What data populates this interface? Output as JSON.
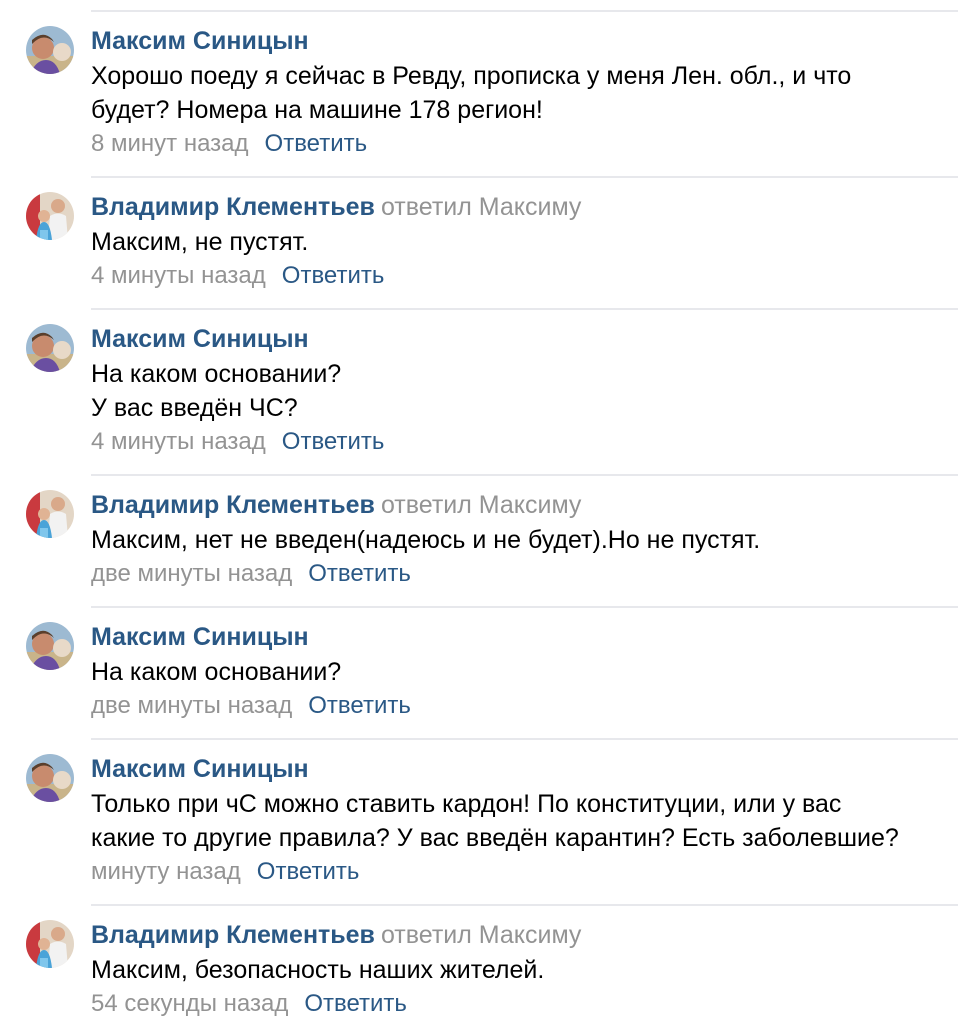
{
  "comments": [
    {
      "author": "Максим Синицын",
      "reply_to": "",
      "avatar": "avatar-maxim",
      "lines": [
        "Хорошо поеду я сейчас в Ревду, прописка у меня Лен. обл., и что",
        "будет? Номера на машине 178 регион!"
      ],
      "time": "8 минут назад",
      "reply_label": "Ответить"
    },
    {
      "author": "Владимир Клементьев",
      "reply_to": "ответил Максиму",
      "avatar": "avatar-vladimir",
      "lines": [
        "Максим, не пустят."
      ],
      "time": "4 минуты назад",
      "reply_label": "Ответить"
    },
    {
      "author": "Максим Синицын",
      "reply_to": "",
      "avatar": "avatar-maxim",
      "lines": [
        "На каком основании?",
        "У вас введён ЧС?"
      ],
      "time": "4 минуты назад",
      "reply_label": "Ответить"
    },
    {
      "author": "Владимир Клементьев",
      "reply_to": "ответил Максиму",
      "avatar": "avatar-vladimir",
      "lines": [
        "Максим, нет не введен(надеюсь и не будет).Но не пустят."
      ],
      "time": "две минуты назад",
      "reply_label": "Ответить"
    },
    {
      "author": "Максим Синицын",
      "reply_to": "",
      "avatar": "avatar-maxim",
      "lines": [
        "На каком основании?"
      ],
      "time": "две минуты назад",
      "reply_label": "Ответить"
    },
    {
      "author": "Максим Синицын",
      "reply_to": "",
      "avatar": "avatar-maxim",
      "lines": [
        "Только при чС можно ставить кардон! По конституции, или у вас",
        "какие то другие правила? У вас введён карантин? Есть заболевшие?"
      ],
      "time": "минуту назад",
      "reply_label": "Ответить"
    },
    {
      "author": "Владимир Клементьев",
      "reply_to": "ответил Максиму",
      "avatar": "avatar-vladimir",
      "lines": [
        "Максим, безопасность наших жителей."
      ],
      "time": "54 секунды назад",
      "reply_label": "Ответить"
    }
  ],
  "colors": {
    "link": "#2a5885",
    "muted": "#939393",
    "text": "#000000",
    "divider": "#e7e8ec"
  }
}
